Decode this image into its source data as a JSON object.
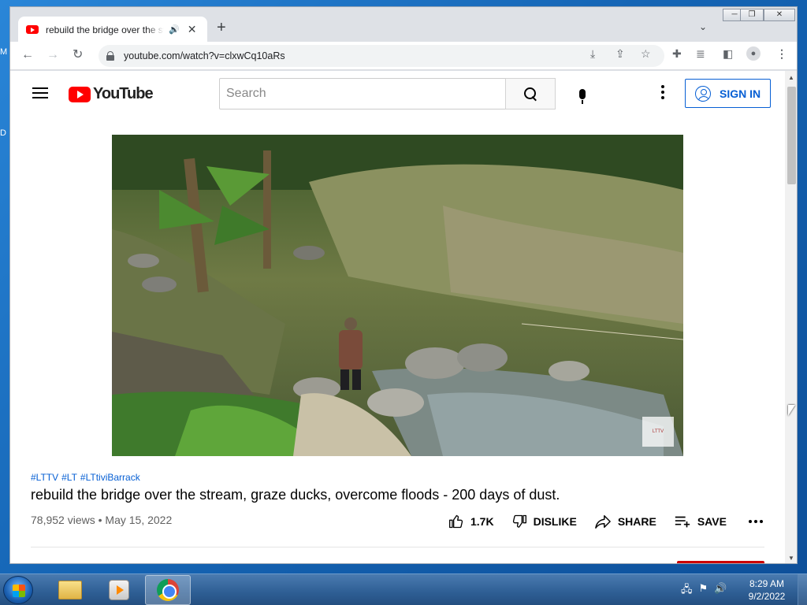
{
  "desktop": {
    "labels": [
      "M",
      "D"
    ]
  },
  "browser": {
    "tab": {
      "title": "rebuild the bridge over the stream, graze ducks, overcome floods - 200 days of dust. - YouTube"
    },
    "url": "youtube.com/watch?v=clxwCq10aRs",
    "window_controls": [
      "─",
      "❐",
      "✕"
    ]
  },
  "youtube": {
    "logo_text": "YouTube",
    "search_placeholder": "Search",
    "sign_in": "SIGN IN"
  },
  "video": {
    "hashtags": [
      "#LTTV",
      "#LT",
      "#LTtiviBarrack"
    ],
    "title": "rebuild the bridge over the stream, graze ducks, overcome floods - 200 days of dust.",
    "views": "78,952 views",
    "separator": "•",
    "date": "May 15, 2022",
    "likes": "1.7K",
    "dislike_label": "DISLIKE",
    "share_label": "SHARE",
    "save_label": "SAVE",
    "watermark": "LTTV"
  },
  "taskbar": {
    "time": "8:29 AM",
    "date": "9/2/2022"
  },
  "colors": {
    "accent": "#065fd4",
    "brand": "#ff0000",
    "taskbar": "#2e5e94"
  }
}
